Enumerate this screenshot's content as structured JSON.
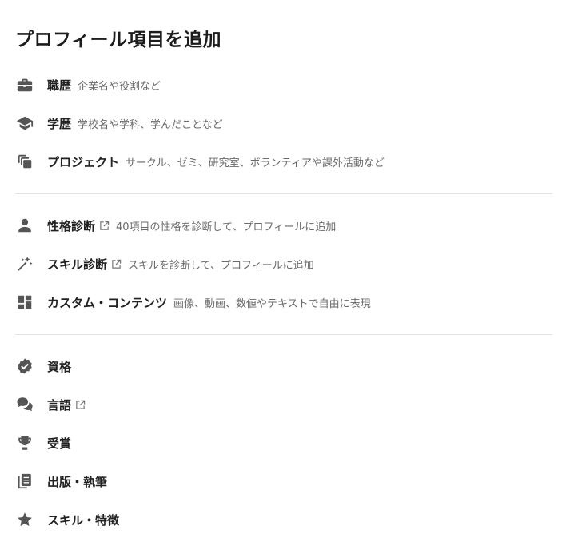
{
  "title": "プロフィール項目を追加",
  "colors": {
    "icon": "#555555",
    "label": "#222222",
    "desc": "#6a6a6a",
    "divider": "#e3e3e3"
  },
  "items": [
    {
      "icon": "briefcase-icon",
      "label": "職歴",
      "external": false,
      "desc": "企業名や役割など"
    },
    {
      "icon": "graduation-cap-icon",
      "label": "学歴",
      "external": false,
      "desc": "学校名や学科、学んだことなど"
    },
    {
      "icon": "stacked-cards-icon",
      "label": "プロジェクト",
      "external": false,
      "desc": "サークル、ゼミ、研究室、ボランティアや課外活動など"
    },
    {
      "icon": "person-icon",
      "label": "性格診断",
      "external": true,
      "desc": "40項目の性格を診断して、プロフィールに追加"
    },
    {
      "icon": "magic-wand-icon",
      "label": "スキル診断",
      "external": true,
      "desc": "スキルを診断して、プロフィールに追加"
    },
    {
      "icon": "dashboard-icon",
      "label": "カスタム・コンテンツ",
      "external": false,
      "desc": "画像、動画、数値やテキストで自由に表現"
    },
    {
      "icon": "verified-badge-icon",
      "label": "資格",
      "external": false,
      "desc": ""
    },
    {
      "icon": "chat-bubbles-icon",
      "label": "言語",
      "external": true,
      "desc": ""
    },
    {
      "icon": "trophy-icon",
      "label": "受賞",
      "external": false,
      "desc": ""
    },
    {
      "icon": "documents-icon",
      "label": "出版・執筆",
      "external": false,
      "desc": ""
    },
    {
      "icon": "star-icon",
      "label": "スキル・特徴",
      "external": false,
      "desc": ""
    }
  ]
}
